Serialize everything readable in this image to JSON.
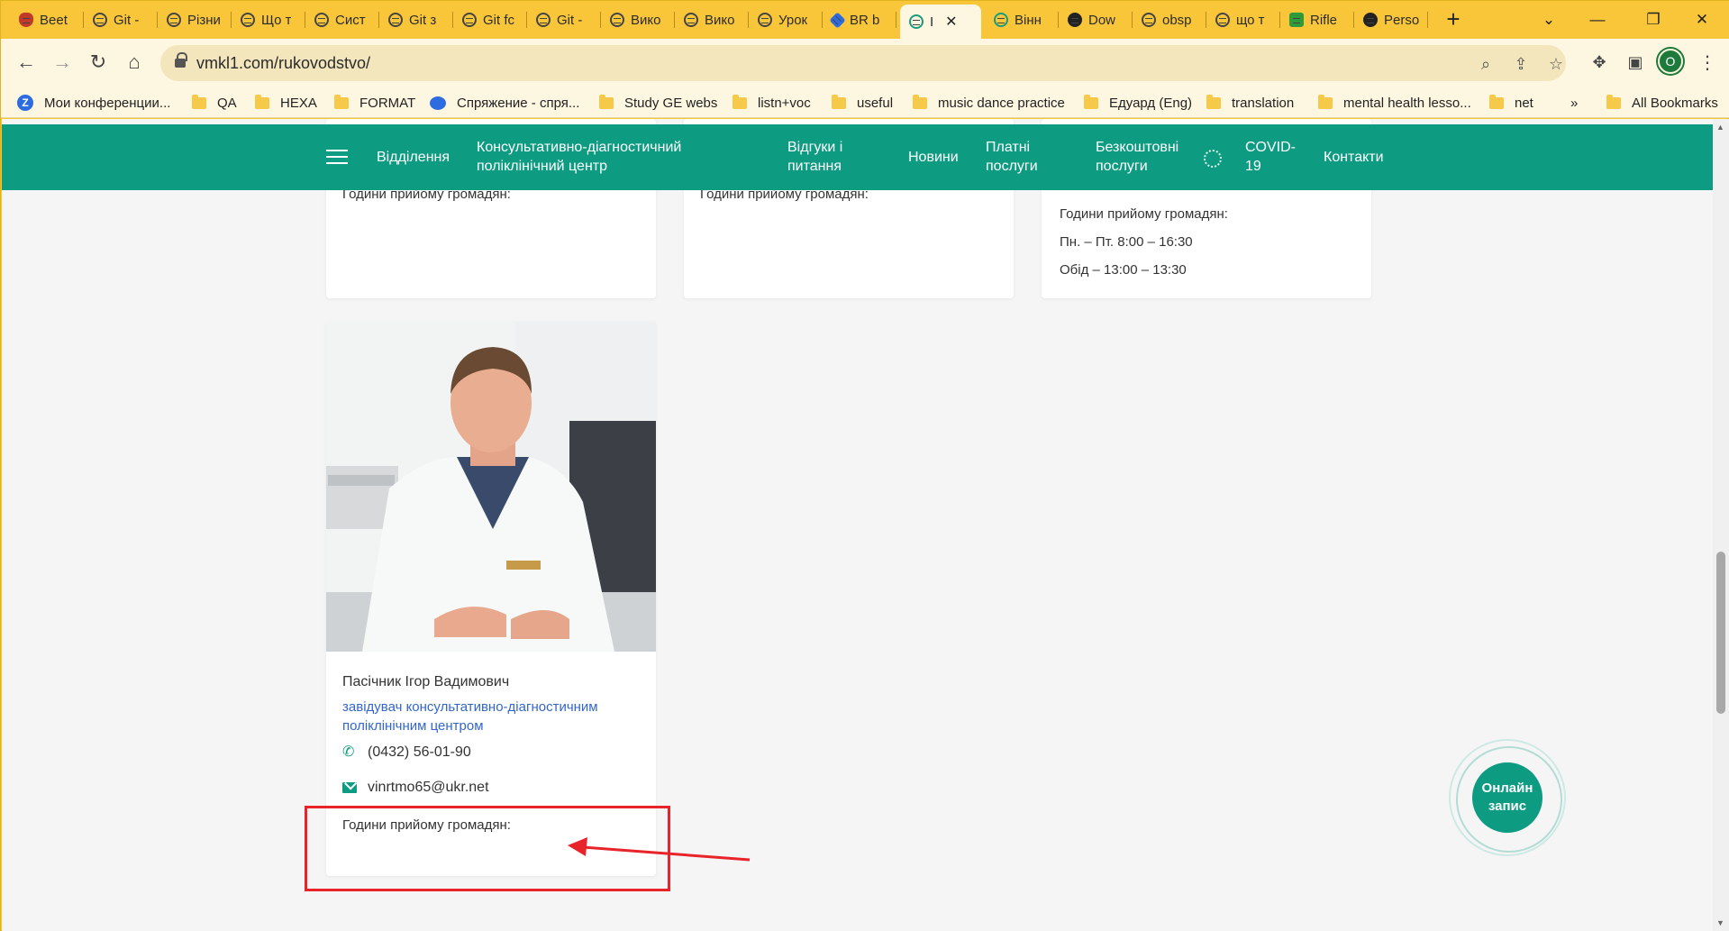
{
  "browser": {
    "tabs": [
      {
        "label": "Beet",
        "icon": "beet-icon"
      },
      {
        "label": "Git -",
        "icon": "globe-icon"
      },
      {
        "label": "Різни",
        "icon": "globe-icon"
      },
      {
        "label": "Що т",
        "icon": "globe-icon"
      },
      {
        "label": "Сист",
        "icon": "globe-icon"
      },
      {
        "label": "Git з",
        "icon": "globe-icon"
      },
      {
        "label": "Git fc",
        "icon": "globe-icon"
      },
      {
        "label": "Git -",
        "icon": "globe-icon"
      },
      {
        "label": "Вико",
        "icon": "globe-icon"
      },
      {
        "label": "Вико",
        "icon": "globe-icon"
      },
      {
        "label": "Урок",
        "icon": "globe-icon"
      },
      {
        "label": "BR b",
        "icon": "diamond-icon"
      },
      {
        "label": "I",
        "icon": "caduceus-icon",
        "active": true
      },
      {
        "label": "Вінн",
        "icon": "caduceus-icon"
      },
      {
        "label": "Dow",
        "icon": "obs-icon"
      },
      {
        "label": "obsp",
        "icon": "globe-icon"
      },
      {
        "label": "що т",
        "icon": "globe-icon"
      },
      {
        "label": "Rifle",
        "icon": "rifle-icon"
      },
      {
        "label": "Perso",
        "icon": "github-icon"
      }
    ],
    "url": "vmkl1.com/rukovodstvo/",
    "profile_initial": "O",
    "bookmarks": [
      {
        "label": "Мои конференции...",
        "icon": "zoom-icon"
      },
      {
        "label": "QA",
        "icon": "folder-icon"
      },
      {
        "label": "HEXA",
        "icon": "folder-icon"
      },
      {
        "label": "FORMAT",
        "icon": "folder-icon"
      },
      {
        "label": "Спряжение - спря...",
        "icon": "chat-bubble-icon"
      },
      {
        "label": "Study GE webs",
        "icon": "folder-icon"
      },
      {
        "label": "listn+voc",
        "icon": "folder-icon"
      },
      {
        "label": "useful",
        "icon": "folder-icon"
      },
      {
        "label": "music dance practice",
        "icon": "folder-icon"
      },
      {
        "label": "Едуард (Eng)",
        "icon": "folder-icon"
      },
      {
        "label": "translation",
        "icon": "folder-icon"
      },
      {
        "label": "mental health lesso...",
        "icon": "folder-icon"
      },
      {
        "label": "net",
        "icon": "folder-icon"
      }
    ],
    "bookmarks_overflow": "»",
    "all_bookmarks": "All Bookmarks"
  },
  "site": {
    "nav": {
      "departments": "Відділення",
      "consult_center": [
        "Консультативно-діагностичний",
        "поліклінічний центр"
      ],
      "reviews": [
        "Відгуки і",
        "питання"
      ],
      "news": "Новини",
      "paid": [
        "Платні",
        "послуги"
      ],
      "free": [
        "Безкоштовні",
        "послуги"
      ],
      "covid": [
        "COVID-",
        "19"
      ],
      "contacts": "Контакти"
    },
    "cards_top": [
      {
        "hours_label": "Години прийому громадян:"
      },
      {
        "hours_label": "Години прийому громадян:"
      },
      {
        "hours_label": "Години прийому громадян:",
        "line1": "Пн. – Пт. 8:00 – 16:30",
        "line2": "Обід – 13:00 – 13:30"
      }
    ],
    "person": {
      "name": "Пасічник Ігор Вадимович",
      "position": [
        "завідувач консультативно-діагностичним",
        "поліклінічним центром"
      ],
      "phone": "(0432) 56-01-90",
      "email": "vinrtmo65@ukr.net",
      "hours_label": "Години прийому громадян:"
    },
    "booking": [
      "Онлайн",
      "запис"
    ]
  },
  "colors": {
    "brand": "#0d9b82",
    "tab_strip": "#f9c63a",
    "annotation": "#e8232a",
    "link": "#3366cc"
  }
}
